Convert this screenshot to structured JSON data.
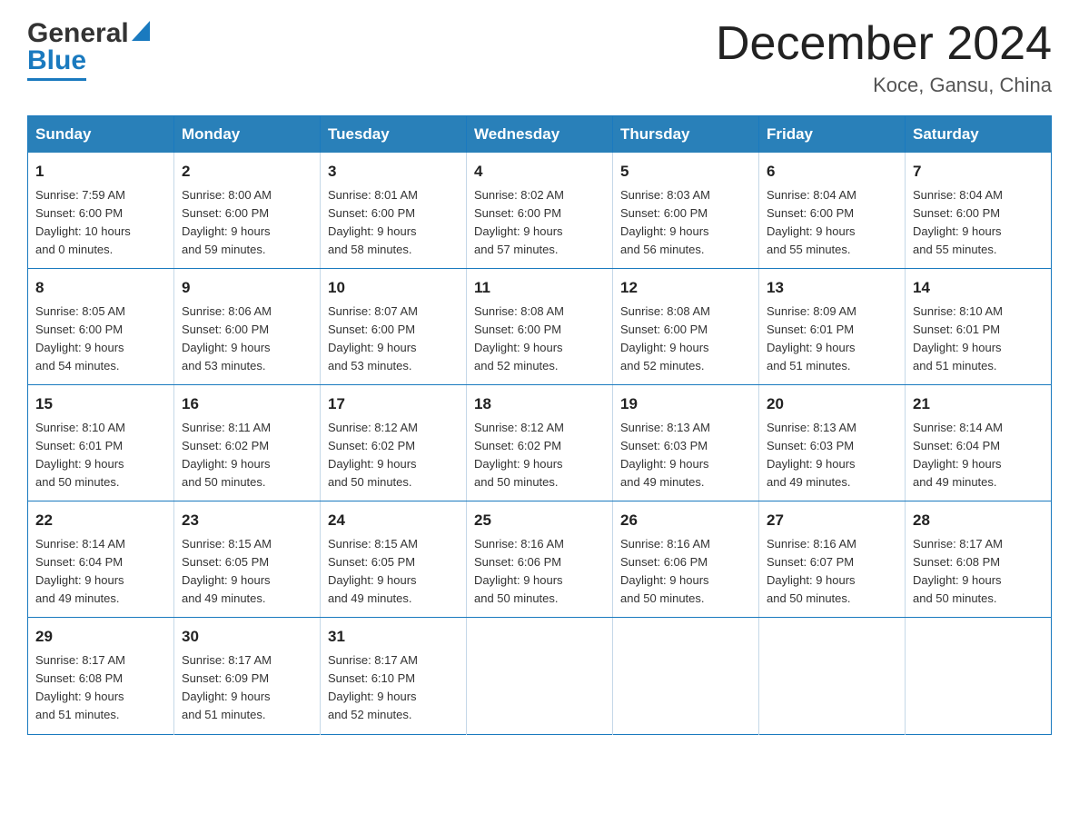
{
  "header": {
    "logo": {
      "general": "General",
      "blue": "Blue"
    },
    "title": "December 2024",
    "location": "Koce, Gansu, China"
  },
  "calendar": {
    "days_of_week": [
      "Sunday",
      "Monday",
      "Tuesday",
      "Wednesday",
      "Thursday",
      "Friday",
      "Saturday"
    ],
    "weeks": [
      [
        {
          "day": "1",
          "sunrise": "Sunrise: 7:59 AM",
          "sunset": "Sunset: 6:00 PM",
          "daylight": "Daylight: 10 hours",
          "daylight2": "and 0 minutes."
        },
        {
          "day": "2",
          "sunrise": "Sunrise: 8:00 AM",
          "sunset": "Sunset: 6:00 PM",
          "daylight": "Daylight: 9 hours",
          "daylight2": "and 59 minutes."
        },
        {
          "day": "3",
          "sunrise": "Sunrise: 8:01 AM",
          "sunset": "Sunset: 6:00 PM",
          "daylight": "Daylight: 9 hours",
          "daylight2": "and 58 minutes."
        },
        {
          "day": "4",
          "sunrise": "Sunrise: 8:02 AM",
          "sunset": "Sunset: 6:00 PM",
          "daylight": "Daylight: 9 hours",
          "daylight2": "and 57 minutes."
        },
        {
          "day": "5",
          "sunrise": "Sunrise: 8:03 AM",
          "sunset": "Sunset: 6:00 PM",
          "daylight": "Daylight: 9 hours",
          "daylight2": "and 56 minutes."
        },
        {
          "day": "6",
          "sunrise": "Sunrise: 8:04 AM",
          "sunset": "Sunset: 6:00 PM",
          "daylight": "Daylight: 9 hours",
          "daylight2": "and 55 minutes."
        },
        {
          "day": "7",
          "sunrise": "Sunrise: 8:04 AM",
          "sunset": "Sunset: 6:00 PM",
          "daylight": "Daylight: 9 hours",
          "daylight2": "and 55 minutes."
        }
      ],
      [
        {
          "day": "8",
          "sunrise": "Sunrise: 8:05 AM",
          "sunset": "Sunset: 6:00 PM",
          "daylight": "Daylight: 9 hours",
          "daylight2": "and 54 minutes."
        },
        {
          "day": "9",
          "sunrise": "Sunrise: 8:06 AM",
          "sunset": "Sunset: 6:00 PM",
          "daylight": "Daylight: 9 hours",
          "daylight2": "and 53 minutes."
        },
        {
          "day": "10",
          "sunrise": "Sunrise: 8:07 AM",
          "sunset": "Sunset: 6:00 PM",
          "daylight": "Daylight: 9 hours",
          "daylight2": "and 53 minutes."
        },
        {
          "day": "11",
          "sunrise": "Sunrise: 8:08 AM",
          "sunset": "Sunset: 6:00 PM",
          "daylight": "Daylight: 9 hours",
          "daylight2": "and 52 minutes."
        },
        {
          "day": "12",
          "sunrise": "Sunrise: 8:08 AM",
          "sunset": "Sunset: 6:00 PM",
          "daylight": "Daylight: 9 hours",
          "daylight2": "and 52 minutes."
        },
        {
          "day": "13",
          "sunrise": "Sunrise: 8:09 AM",
          "sunset": "Sunset: 6:01 PM",
          "daylight": "Daylight: 9 hours",
          "daylight2": "and 51 minutes."
        },
        {
          "day": "14",
          "sunrise": "Sunrise: 8:10 AM",
          "sunset": "Sunset: 6:01 PM",
          "daylight": "Daylight: 9 hours",
          "daylight2": "and 51 minutes."
        }
      ],
      [
        {
          "day": "15",
          "sunrise": "Sunrise: 8:10 AM",
          "sunset": "Sunset: 6:01 PM",
          "daylight": "Daylight: 9 hours",
          "daylight2": "and 50 minutes."
        },
        {
          "day": "16",
          "sunrise": "Sunrise: 8:11 AM",
          "sunset": "Sunset: 6:02 PM",
          "daylight": "Daylight: 9 hours",
          "daylight2": "and 50 minutes."
        },
        {
          "day": "17",
          "sunrise": "Sunrise: 8:12 AM",
          "sunset": "Sunset: 6:02 PM",
          "daylight": "Daylight: 9 hours",
          "daylight2": "and 50 minutes."
        },
        {
          "day": "18",
          "sunrise": "Sunrise: 8:12 AM",
          "sunset": "Sunset: 6:02 PM",
          "daylight": "Daylight: 9 hours",
          "daylight2": "and 50 minutes."
        },
        {
          "day": "19",
          "sunrise": "Sunrise: 8:13 AM",
          "sunset": "Sunset: 6:03 PM",
          "daylight": "Daylight: 9 hours",
          "daylight2": "and 49 minutes."
        },
        {
          "day": "20",
          "sunrise": "Sunrise: 8:13 AM",
          "sunset": "Sunset: 6:03 PM",
          "daylight": "Daylight: 9 hours",
          "daylight2": "and 49 minutes."
        },
        {
          "day": "21",
          "sunrise": "Sunrise: 8:14 AM",
          "sunset": "Sunset: 6:04 PM",
          "daylight": "Daylight: 9 hours",
          "daylight2": "and 49 minutes."
        }
      ],
      [
        {
          "day": "22",
          "sunrise": "Sunrise: 8:14 AM",
          "sunset": "Sunset: 6:04 PM",
          "daylight": "Daylight: 9 hours",
          "daylight2": "and 49 minutes."
        },
        {
          "day": "23",
          "sunrise": "Sunrise: 8:15 AM",
          "sunset": "Sunset: 6:05 PM",
          "daylight": "Daylight: 9 hours",
          "daylight2": "and 49 minutes."
        },
        {
          "day": "24",
          "sunrise": "Sunrise: 8:15 AM",
          "sunset": "Sunset: 6:05 PM",
          "daylight": "Daylight: 9 hours",
          "daylight2": "and 49 minutes."
        },
        {
          "day": "25",
          "sunrise": "Sunrise: 8:16 AM",
          "sunset": "Sunset: 6:06 PM",
          "daylight": "Daylight: 9 hours",
          "daylight2": "and 50 minutes."
        },
        {
          "day": "26",
          "sunrise": "Sunrise: 8:16 AM",
          "sunset": "Sunset: 6:06 PM",
          "daylight": "Daylight: 9 hours",
          "daylight2": "and 50 minutes."
        },
        {
          "day": "27",
          "sunrise": "Sunrise: 8:16 AM",
          "sunset": "Sunset: 6:07 PM",
          "daylight": "Daylight: 9 hours",
          "daylight2": "and 50 minutes."
        },
        {
          "day": "28",
          "sunrise": "Sunrise: 8:17 AM",
          "sunset": "Sunset: 6:08 PM",
          "daylight": "Daylight: 9 hours",
          "daylight2": "and 50 minutes."
        }
      ],
      [
        {
          "day": "29",
          "sunrise": "Sunrise: 8:17 AM",
          "sunset": "Sunset: 6:08 PM",
          "daylight": "Daylight: 9 hours",
          "daylight2": "and 51 minutes."
        },
        {
          "day": "30",
          "sunrise": "Sunrise: 8:17 AM",
          "sunset": "Sunset: 6:09 PM",
          "daylight": "Daylight: 9 hours",
          "daylight2": "and 51 minutes."
        },
        {
          "day": "31",
          "sunrise": "Sunrise: 8:17 AM",
          "sunset": "Sunset: 6:10 PM",
          "daylight": "Daylight: 9 hours",
          "daylight2": "and 52 minutes."
        },
        null,
        null,
        null,
        null
      ]
    ]
  }
}
